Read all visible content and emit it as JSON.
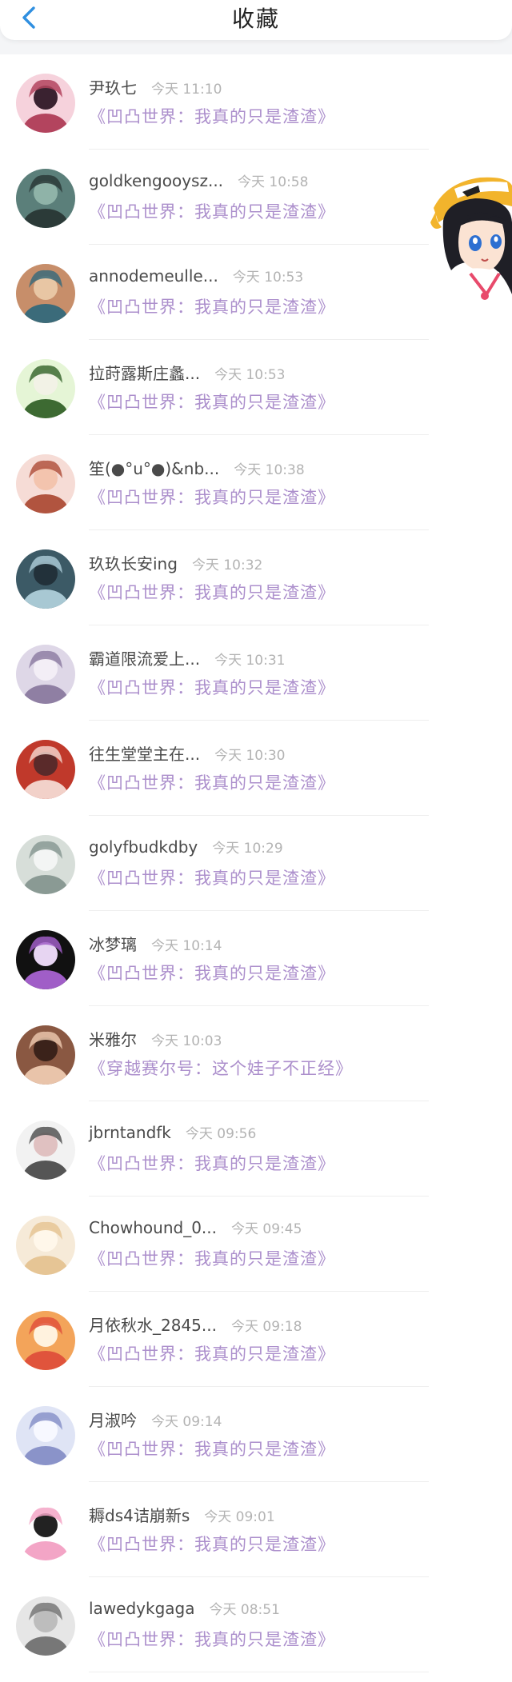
{
  "header": {
    "title": "收藏",
    "back_icon": "chevron-left-icon",
    "accent_color": "#2f8fe0"
  },
  "colors": {
    "book_title": "#ac8fcc",
    "username": "#4a4a4a",
    "timestamp": "#b3b3b3"
  },
  "items": [
    {
      "name": "尹玖七",
      "time": "今天 11:10",
      "book": "《凹凸世界：我真的只是渣渣》"
    },
    {
      "name": "goldkengooysz...",
      "time": "今天 10:58",
      "book": "《凹凸世界：我真的只是渣渣》"
    },
    {
      "name": "annodemeulle...",
      "time": "今天 10:53",
      "book": "《凹凸世界：我真的只是渣渣》"
    },
    {
      "name": "拉莳露斯庄蠡...",
      "time": "今天 10:53",
      "book": "《凹凸世界：我真的只是渣渣》"
    },
    {
      "name": "笙(●°u°●)&nb...",
      "time": "今天 10:38",
      "book": "《凹凸世界：我真的只是渣渣》"
    },
    {
      "name": "玖玖长安ing",
      "time": "今天 10:32",
      "book": "《凹凸世界：我真的只是渣渣》"
    },
    {
      "name": "霸道限流爱上...",
      "time": "今天 10:31",
      "book": "《凹凸世界：我真的只是渣渣》"
    },
    {
      "name": "往生堂堂主在...",
      "time": "今天 10:30",
      "book": "《凹凸世界：我真的只是渣渣》"
    },
    {
      "name": "golyfbudkdby",
      "time": "今天 10:29",
      "book": "《凹凸世界：我真的只是渣渣》"
    },
    {
      "name": "冰梦璃",
      "time": "今天 10:14",
      "book": "《凹凸世界：我真的只是渣渣》"
    },
    {
      "name": "米雅尔",
      "time": "今天 10:03",
      "book": "《穿越赛尔号：这个娃子不正经》"
    },
    {
      "name": "jbrntandfk",
      "time": "今天 09:56",
      "book": "《凹凸世界：我真的只是渣渣》"
    },
    {
      "name": "Chowhound_0...",
      "time": "今天 09:45",
      "book": "《凹凸世界：我真的只是渣渣》"
    },
    {
      "name": "月依秋水_2845...",
      "time": "今天 09:18",
      "book": "《凹凸世界：我真的只是渣渣》"
    },
    {
      "name": "月淑吟",
      "time": "今天 09:14",
      "book": "《凹凸世界：我真的只是渣渣》"
    },
    {
      "name": "耨ds4诘崩新s",
      "time": "今天 09:01",
      "book": "《凹凸世界：我真的只是渣渣》"
    },
    {
      "name": "lawedykgaga",
      "time": "今天 08:51",
      "book": "《凹凸世界：我真的只是渣渣》"
    }
  ],
  "avatar_palette": [
    [
      "#f6d2dc",
      "#b3445e",
      "#3a2230"
    ],
    [
      "#5b7f7a",
      "#2b3a38",
      "#8fb3a8"
    ],
    [
      "#c78e6a",
      "#3b6b7a",
      "#e8c6a4"
    ],
    [
      "#e5f5d6",
      "#3d6a32",
      "#f2f2e6"
    ],
    [
      "#f6dcd6",
      "#b1543f",
      "#f3c4ae"
    ],
    [
      "#3c5a66",
      "#a8c8d3",
      "#22313a"
    ],
    [
      "#ded7e7",
      "#8f7fa3",
      "#f3eef6"
    ],
    [
      "#c0392b",
      "#f2d1c9",
      "#5a2a2a"
    ],
    [
      "#d7ded9",
      "#8a9a94",
      "#f3f5f4"
    ],
    [
      "#111111",
      "#a05ec7",
      "#e7d5f2"
    ],
    [
      "#8a5842",
      "#e9c4aa",
      "#3b221a"
    ],
    [
      "#f2f2f2",
      "#555555",
      "#e0c1c1"
    ],
    [
      "#f6ead8",
      "#e6c595",
      "#fff7ea"
    ],
    [
      "#f3a45a",
      "#e0543c",
      "#fff2de"
    ],
    [
      "#dfe4f5",
      "#8a93c9",
      "#f7f8ff"
    ],
    [
      "#ffffff",
      "#f3a5c6",
      "#222222"
    ],
    [
      "#e6e6e6",
      "#777777",
      "#bdbdbd"
    ]
  ]
}
